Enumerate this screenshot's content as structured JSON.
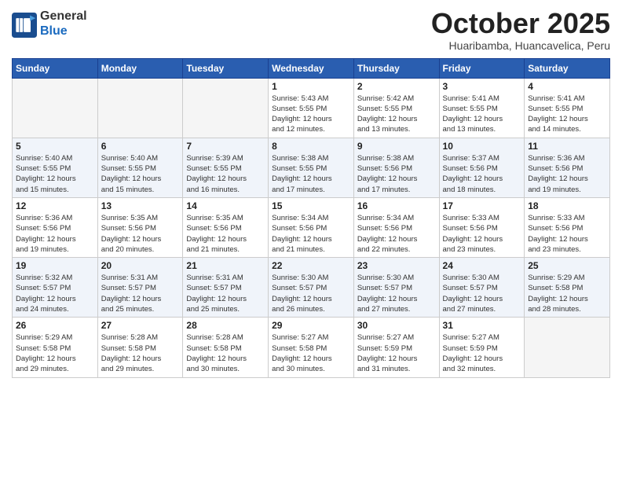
{
  "header": {
    "logo_general": "General",
    "logo_blue": "Blue",
    "month_title": "October 2025",
    "location": "Huaribamba, Huancavelica, Peru"
  },
  "weekdays": [
    "Sunday",
    "Monday",
    "Tuesday",
    "Wednesday",
    "Thursday",
    "Friday",
    "Saturday"
  ],
  "weeks": [
    [
      {
        "day": "",
        "info": ""
      },
      {
        "day": "",
        "info": ""
      },
      {
        "day": "",
        "info": ""
      },
      {
        "day": "1",
        "info": "Sunrise: 5:43 AM\nSunset: 5:55 PM\nDaylight: 12 hours\nand 12 minutes."
      },
      {
        "day": "2",
        "info": "Sunrise: 5:42 AM\nSunset: 5:55 PM\nDaylight: 12 hours\nand 13 minutes."
      },
      {
        "day": "3",
        "info": "Sunrise: 5:41 AM\nSunset: 5:55 PM\nDaylight: 12 hours\nand 13 minutes."
      },
      {
        "day": "4",
        "info": "Sunrise: 5:41 AM\nSunset: 5:55 PM\nDaylight: 12 hours\nand 14 minutes."
      }
    ],
    [
      {
        "day": "5",
        "info": "Sunrise: 5:40 AM\nSunset: 5:55 PM\nDaylight: 12 hours\nand 15 minutes."
      },
      {
        "day": "6",
        "info": "Sunrise: 5:40 AM\nSunset: 5:55 PM\nDaylight: 12 hours\nand 15 minutes."
      },
      {
        "day": "7",
        "info": "Sunrise: 5:39 AM\nSunset: 5:55 PM\nDaylight: 12 hours\nand 16 minutes."
      },
      {
        "day": "8",
        "info": "Sunrise: 5:38 AM\nSunset: 5:55 PM\nDaylight: 12 hours\nand 17 minutes."
      },
      {
        "day": "9",
        "info": "Sunrise: 5:38 AM\nSunset: 5:56 PM\nDaylight: 12 hours\nand 17 minutes."
      },
      {
        "day": "10",
        "info": "Sunrise: 5:37 AM\nSunset: 5:56 PM\nDaylight: 12 hours\nand 18 minutes."
      },
      {
        "day": "11",
        "info": "Sunrise: 5:36 AM\nSunset: 5:56 PM\nDaylight: 12 hours\nand 19 minutes."
      }
    ],
    [
      {
        "day": "12",
        "info": "Sunrise: 5:36 AM\nSunset: 5:56 PM\nDaylight: 12 hours\nand 19 minutes."
      },
      {
        "day": "13",
        "info": "Sunrise: 5:35 AM\nSunset: 5:56 PM\nDaylight: 12 hours\nand 20 minutes."
      },
      {
        "day": "14",
        "info": "Sunrise: 5:35 AM\nSunset: 5:56 PM\nDaylight: 12 hours\nand 21 minutes."
      },
      {
        "day": "15",
        "info": "Sunrise: 5:34 AM\nSunset: 5:56 PM\nDaylight: 12 hours\nand 21 minutes."
      },
      {
        "day": "16",
        "info": "Sunrise: 5:34 AM\nSunset: 5:56 PM\nDaylight: 12 hours\nand 22 minutes."
      },
      {
        "day": "17",
        "info": "Sunrise: 5:33 AM\nSunset: 5:56 PM\nDaylight: 12 hours\nand 23 minutes."
      },
      {
        "day": "18",
        "info": "Sunrise: 5:33 AM\nSunset: 5:56 PM\nDaylight: 12 hours\nand 23 minutes."
      }
    ],
    [
      {
        "day": "19",
        "info": "Sunrise: 5:32 AM\nSunset: 5:57 PM\nDaylight: 12 hours\nand 24 minutes."
      },
      {
        "day": "20",
        "info": "Sunrise: 5:31 AM\nSunset: 5:57 PM\nDaylight: 12 hours\nand 25 minutes."
      },
      {
        "day": "21",
        "info": "Sunrise: 5:31 AM\nSunset: 5:57 PM\nDaylight: 12 hours\nand 25 minutes."
      },
      {
        "day": "22",
        "info": "Sunrise: 5:30 AM\nSunset: 5:57 PM\nDaylight: 12 hours\nand 26 minutes."
      },
      {
        "day": "23",
        "info": "Sunrise: 5:30 AM\nSunset: 5:57 PM\nDaylight: 12 hours\nand 27 minutes."
      },
      {
        "day": "24",
        "info": "Sunrise: 5:30 AM\nSunset: 5:57 PM\nDaylight: 12 hours\nand 27 minutes."
      },
      {
        "day": "25",
        "info": "Sunrise: 5:29 AM\nSunset: 5:58 PM\nDaylight: 12 hours\nand 28 minutes."
      }
    ],
    [
      {
        "day": "26",
        "info": "Sunrise: 5:29 AM\nSunset: 5:58 PM\nDaylight: 12 hours\nand 29 minutes."
      },
      {
        "day": "27",
        "info": "Sunrise: 5:28 AM\nSunset: 5:58 PM\nDaylight: 12 hours\nand 29 minutes."
      },
      {
        "day": "28",
        "info": "Sunrise: 5:28 AM\nSunset: 5:58 PM\nDaylight: 12 hours\nand 30 minutes."
      },
      {
        "day": "29",
        "info": "Sunrise: 5:27 AM\nSunset: 5:58 PM\nDaylight: 12 hours\nand 30 minutes."
      },
      {
        "day": "30",
        "info": "Sunrise: 5:27 AM\nSunset: 5:59 PM\nDaylight: 12 hours\nand 31 minutes."
      },
      {
        "day": "31",
        "info": "Sunrise: 5:27 AM\nSunset: 5:59 PM\nDaylight: 12 hours\nand 32 minutes."
      },
      {
        "day": "",
        "info": ""
      }
    ]
  ]
}
